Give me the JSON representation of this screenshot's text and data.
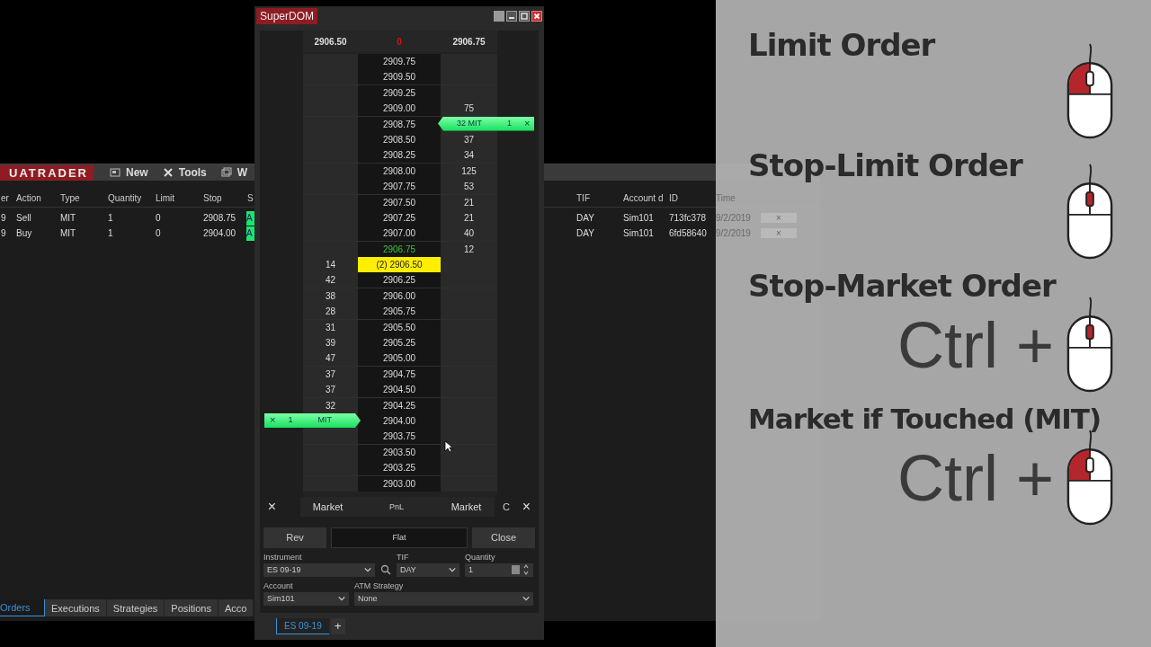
{
  "back_window": {
    "logo": "UATRADER",
    "toolbar": [
      {
        "label": "New"
      },
      {
        "label": "Tools"
      },
      {
        "label": "W"
      }
    ],
    "columns": [
      "er",
      "Action",
      "Type",
      "Quantity",
      "Limit",
      "Stop",
      "S",
      "TIF",
      "Account d",
      "ID",
      "Time"
    ],
    "rows": [
      {
        "cells": [
          "9",
          "Sell",
          "MIT",
          "1",
          "0",
          "2908.75",
          "A",
          "DAY",
          "Sim101",
          "713fc378",
          "9/2/2019",
          "×"
        ]
      },
      {
        "cells": [
          "9",
          "Buy",
          "MIT",
          "1",
          "0",
          "2904.00",
          "A",
          "DAY",
          "Sim101",
          "6fd58640",
          "9/2/2019",
          "×"
        ]
      }
    ],
    "tabs": [
      {
        "label": "Orders",
        "selected": true
      },
      {
        "label": "Executions",
        "selected": false
      },
      {
        "label": "Strategies",
        "selected": false
      },
      {
        "label": "Positions",
        "selected": false
      },
      {
        "label": "Acco",
        "selected": false
      }
    ]
  },
  "superdom": {
    "title": "SuperDOM",
    "header": {
      "bid": "2906.50",
      "pnl": "0",
      "ask": "2906.75"
    },
    "ladder": [
      {
        "price": "2909.75",
        "kind": "normal"
      },
      {
        "price": "2909.50",
        "kind": "normal"
      },
      {
        "price": "2909.25",
        "kind": "normal"
      },
      {
        "price": "2909.00",
        "ask": "75",
        "kind": "normal"
      },
      {
        "price": "2908.75",
        "kind": "normal",
        "order": {
          "kind": "sell",
          "label": "32 MIT",
          "qty": "1",
          "close": "×"
        }
      },
      {
        "price": "2908.50",
        "ask": "37",
        "kind": "normal"
      },
      {
        "price": "2908.25",
        "ask": "34",
        "kind": "normal"
      },
      {
        "price": "2908.00",
        "ask": "125",
        "kind": "normal"
      },
      {
        "price": "2907.75",
        "ask": "53",
        "kind": "normal"
      },
      {
        "price": "2907.50",
        "ask": "21",
        "kind": "normal"
      },
      {
        "price": "2907.25",
        "ask": "21",
        "kind": "normal"
      },
      {
        "price": "2907.00",
        "ask": "40",
        "kind": "normal"
      },
      {
        "price": "2906.75",
        "ask": "12",
        "kind": "last"
      },
      {
        "bid": "14",
        "price": "(2) 2906.50",
        "kind": "current"
      },
      {
        "bid": "42",
        "price": "2906.25",
        "kind": "normal"
      },
      {
        "bid": "38",
        "price": "2906.00",
        "kind": "normal"
      },
      {
        "bid": "28",
        "price": "2905.75",
        "kind": "normal"
      },
      {
        "bid": "31",
        "price": "2905.50",
        "kind": "normal"
      },
      {
        "bid": "39",
        "price": "2905.25",
        "kind": "normal"
      },
      {
        "bid": "47",
        "price": "2905.00",
        "kind": "normal"
      },
      {
        "bid": "37",
        "price": "2904.75",
        "kind": "normal"
      },
      {
        "bid": "37",
        "price": "2904.50",
        "kind": "normal"
      },
      {
        "bid": "32",
        "price": "2904.25",
        "kind": "normal"
      },
      {
        "price": "2904.00",
        "kind": "normal",
        "order": {
          "kind": "buy",
          "label": "MIT",
          "qty": "1",
          "close": "×"
        }
      },
      {
        "price": "2903.75",
        "kind": "normal"
      },
      {
        "price": "2903.50",
        "kind": "normal"
      },
      {
        "price": "2903.25",
        "kind": "normal"
      },
      {
        "price": "2903.00",
        "kind": "normal"
      }
    ],
    "footer": {
      "left_close": "×",
      "bid_market": "Market",
      "pnl": "PnL",
      "ask_market": "Market",
      "center": "C",
      "right_close": "×"
    },
    "buttons": {
      "rev": "Rev",
      "flat": "Flat",
      "close": "Close"
    },
    "instrument": {
      "label": "Instrument",
      "value": "ES 09-19"
    },
    "tif": {
      "label": "TIF",
      "value": "DAY"
    },
    "quantity": {
      "label": "Quantity",
      "value": "1"
    },
    "account": {
      "label": "Account",
      "value": "Sim101"
    },
    "atm": {
      "label": "ATM Strategy",
      "value": "None"
    },
    "tabs": [
      {
        "label": "ES 09-19",
        "selected": true
      }
    ],
    "add_tab": "+"
  },
  "legend": [
    {
      "title": "Limit Order",
      "kind": "left"
    },
    {
      "title": "Stop-Limit Order",
      "kind": "wheel"
    },
    {
      "title": "Stop-Market Order",
      "modifier": "Ctrl +",
      "kind": "wheel"
    },
    {
      "title": "Market if Touched (MIT)",
      "modifier": "Ctrl +",
      "kind": "left"
    }
  ]
}
